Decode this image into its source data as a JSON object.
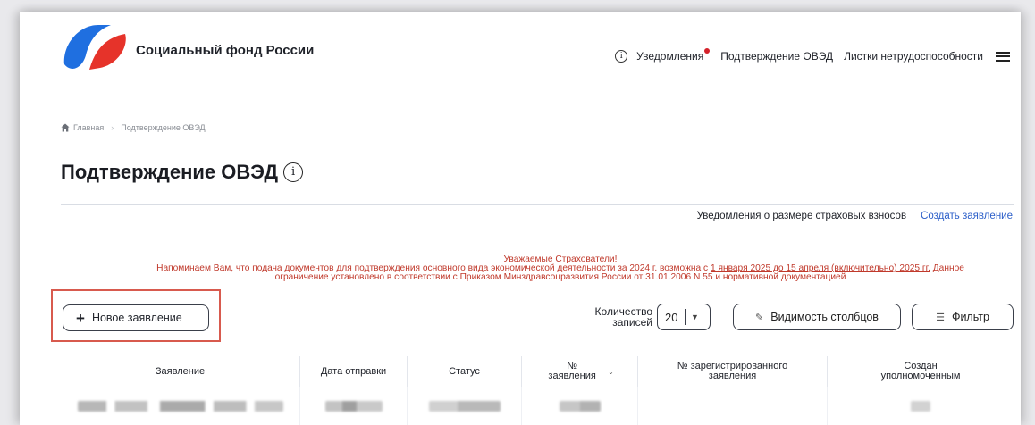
{
  "header": {
    "logo_text": "Социальный фонд России",
    "nav": {
      "notifications": "Уведомления",
      "confirm_oved": "Подтверждение ОВЭД",
      "sick_leave": "Листки нетрудоспособности"
    },
    "icons": [
      "logo-icon",
      "info-icon",
      "notification-dot",
      "menu-icon"
    ]
  },
  "breadcrumb": {
    "home": "Главная",
    "current": "Подтверждение ОВЭД"
  },
  "page_title": "Подтверждение ОВЭД",
  "sublinks": {
    "insurance_notifications": "Уведомления о размере страховых взносов",
    "create_application": "Создать заявление"
  },
  "notice": {
    "line1": "Уважаемые Страхователи!",
    "part1": "Напоминаем Вам, что подача документов для подтверждения основного вида экономической деятельности за 2024 г. возможна с ",
    "link": "1 января 2025 до 15 апреля (включительно) 2025 гг.",
    "part2": " Данное ограничение установлено в соответствии с Приказом Минздравсоцразвития России от 31.01.2006 N 55 и нормативной документацией"
  },
  "toolbar": {
    "new_application": "Новое заявление",
    "count_label_1": "Количество",
    "count_label_2": "записей",
    "count_value": "20",
    "columns_visibility": "Видимость столбцов",
    "filter": "Фильтр"
  },
  "table": {
    "headers": [
      "Заявление",
      "Дата отправки",
      "Статус",
      "№ заявления",
      "№ зарегистрированного заявления",
      "Создан уполномоченным"
    ]
  },
  "colors": {
    "brand_blue": "#1f6fe0",
    "brand_red": "#e6332a",
    "notice_red": "#c0392b",
    "link_blue": "#2c5fc9",
    "highlight": "#d85a4e"
  }
}
